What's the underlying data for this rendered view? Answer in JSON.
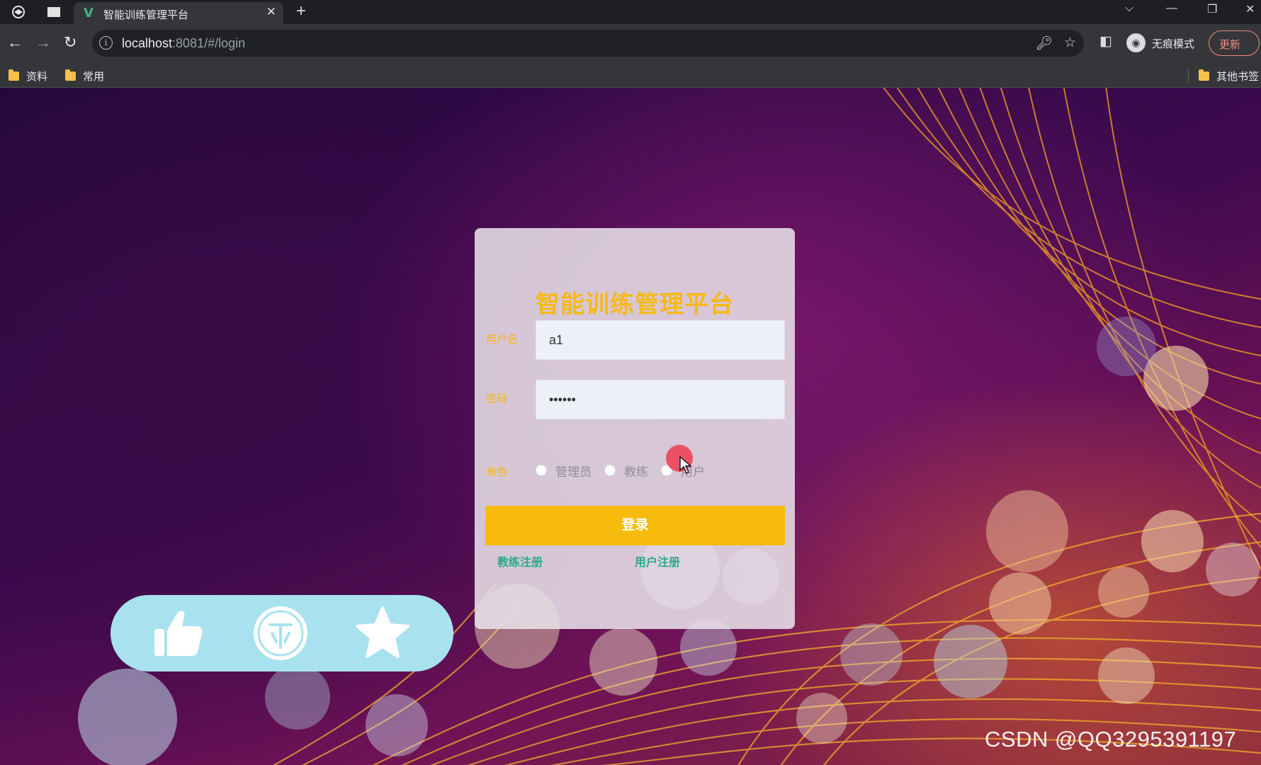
{
  "browser": {
    "tab_title": "智能训练管理平台",
    "tab_favicon": "V",
    "url_host": "localhost",
    "url_rest": ":8081/#/login",
    "incognito_label": "无痕模式",
    "update_label": "更新",
    "bookmarks": [
      {
        "label": "资料"
      },
      {
        "label": "常用"
      }
    ],
    "other_bookmarks": "其他书签"
  },
  "login": {
    "title": "智能训练管理平台",
    "username_label": "用户名",
    "username_value": "a1",
    "password_label": "密码",
    "password_value": "••••••",
    "role_label": "角色",
    "roles": [
      "管理员",
      "教练",
      "用户"
    ],
    "login_button": "登录",
    "coach_register": "教练注册",
    "user_register": "用户注册"
  },
  "share_bar": {
    "icons": [
      "thumbs-up-icon",
      "coin-icon",
      "star-icon"
    ],
    "color": "#a8e2ef"
  },
  "watermark": "CSDN @QQ3295391197",
  "colors": {
    "accent": "#f6bb0d",
    "link": "#2aa889"
  }
}
